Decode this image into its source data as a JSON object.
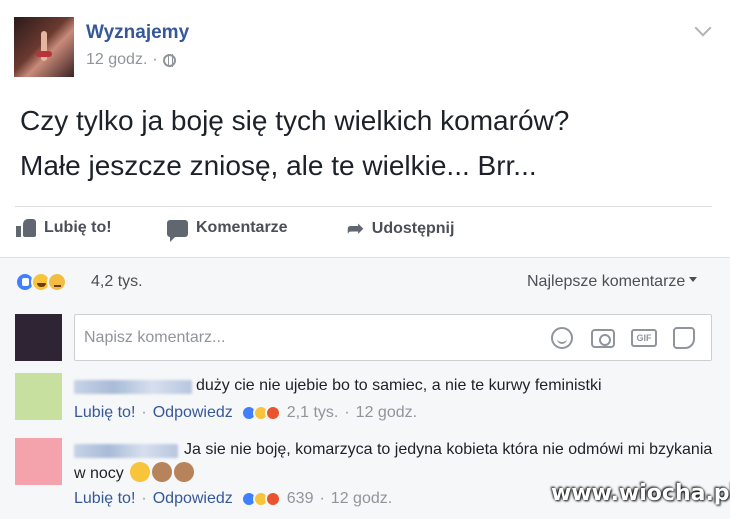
{
  "post": {
    "author": "Wyznajemy",
    "time": "12 godz.",
    "separator": "·",
    "text_line1": "Czy tylko ja boję się tych wielkich komarów?",
    "text_line2": "Małe jeszcze zniosę, ale te wielkie... Brr..."
  },
  "actions": {
    "like": "Lubię to!",
    "comment": "Komentarze",
    "share": "Udostępnij"
  },
  "reactions": {
    "icons": [
      "like",
      "haha",
      "sad"
    ],
    "count": "4,2 tys.",
    "sort": "Najlepsze komentarze"
  },
  "composer": {
    "placeholder": "Napisz komentarz..."
  },
  "comments": [
    {
      "text": "duży cie nie ujebie bo to samiec, a nie te kurwy feministki",
      "like_label": "Lubię to!",
      "reply_label": "Odpowiedz",
      "reaction_count": "2,1 tys.",
      "time": "12 godz.",
      "avatar_color": "#c7e0a0"
    },
    {
      "text": "Ja sie nie boję, komarzyca to jedyna kobieta która nie odmówi mi bzykania w nocy",
      "like_label": "Lubię to!",
      "reply_label": "Odpowiedz",
      "reaction_count": "639",
      "time": "12 godz.",
      "avatar_color": "#f4a3ad"
    }
  ],
  "watermark": "www.wiocha.pl",
  "colors": {
    "link": "#365899",
    "muted": "#90949c",
    "like_blue": "#4080ff"
  }
}
